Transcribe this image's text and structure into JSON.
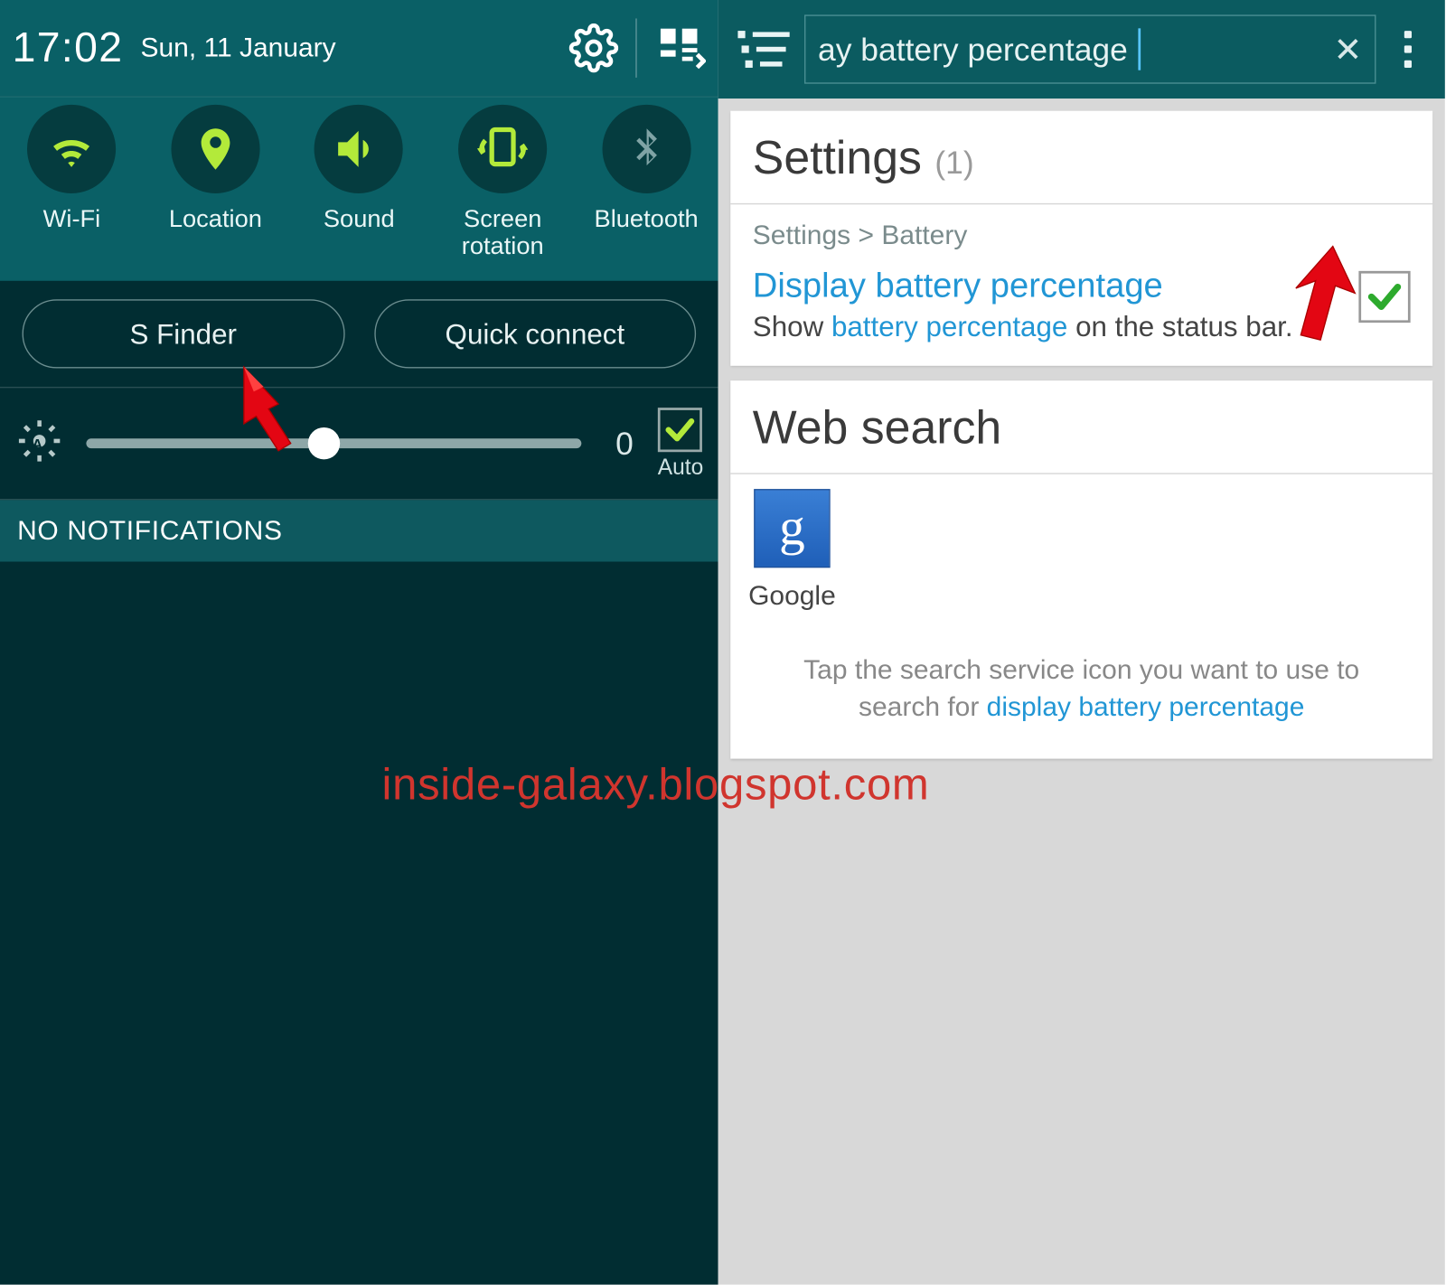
{
  "left": {
    "time": "17:02",
    "date": "Sun, 11 January",
    "toggles": [
      {
        "name": "wifi",
        "label": "Wi-Fi",
        "active": true
      },
      {
        "name": "location",
        "label": "Location",
        "active": true
      },
      {
        "name": "sound",
        "label": "Sound",
        "active": true
      },
      {
        "name": "rotation",
        "label": "Screen rotation",
        "active": true
      },
      {
        "name": "bluetooth",
        "label": "Bluetooth",
        "active": false
      }
    ],
    "buttons": {
      "sfinder": "S Finder",
      "quickconnect": "Quick connect"
    },
    "brightness": {
      "value": "0",
      "auto_label": "Auto",
      "auto_checked": true,
      "slider_position_pct": 48
    },
    "no_notifications": "NO NOTIFICATIONS"
  },
  "right": {
    "search_text": "ay battery percentage",
    "settings_card": {
      "title": "Settings",
      "count": "(1)",
      "breadcrumb": "Settings > Battery",
      "result_title": "Display battery percentage",
      "result_desc_pre": "Show ",
      "result_desc_hl": "battery percentage",
      "result_desc_post": " on the status bar.",
      "checked": true
    },
    "web_card": {
      "title": "Web search",
      "app_label": "Google",
      "hint_pre": "Tap the search service icon you want to use to search for ",
      "hint_hl": "display battery percentage"
    }
  },
  "watermark": "inside-galaxy.blogspot.com",
  "colors": {
    "teal_header": "#0a6066",
    "teal_dark": "#012d32",
    "lime": "#b3ea3a",
    "blue_link": "#2196d5"
  }
}
